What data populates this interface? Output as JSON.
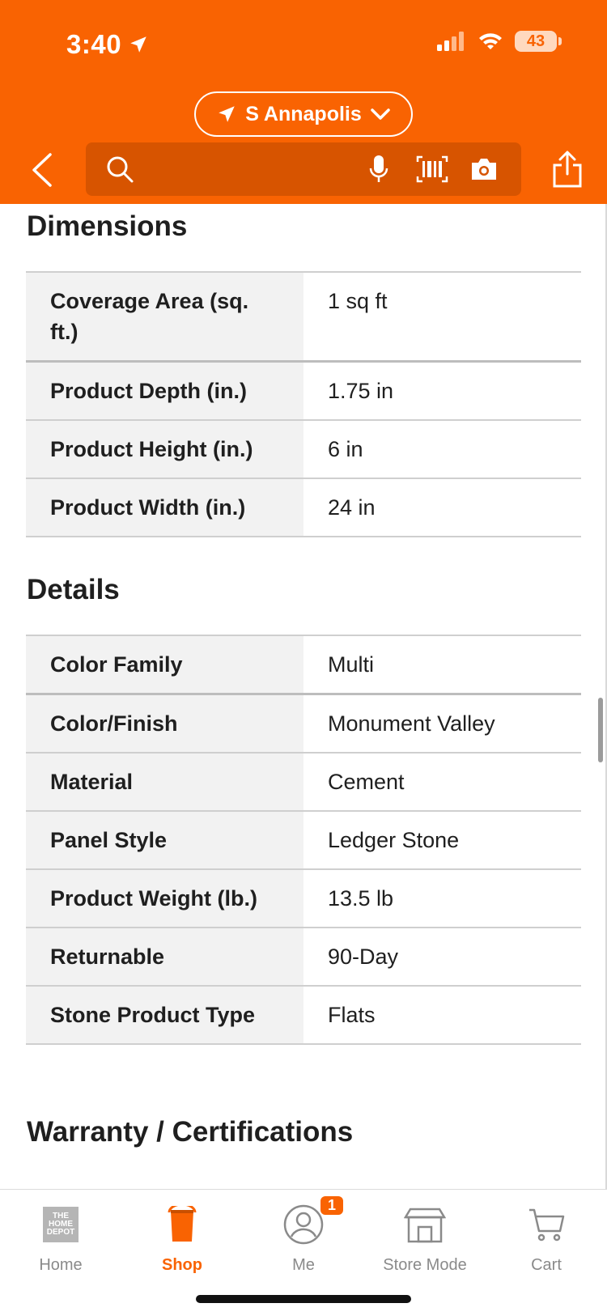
{
  "status_bar": {
    "time": "3:40",
    "battery": "43"
  },
  "header": {
    "store_name": "S Annapolis",
    "search_placeholder": ""
  },
  "sections": {
    "dimensions": {
      "title": "Dimensions",
      "rows": [
        {
          "label": "Coverage Area (sq. ft.)",
          "value": "1 sq ft"
        },
        {
          "label": "Product Depth (in.)",
          "value": "1.75 in"
        },
        {
          "label": "Product Height (in.)",
          "value": "6 in"
        },
        {
          "label": "Product Width (in.)",
          "value": "24 in"
        }
      ]
    },
    "details": {
      "title": "Details",
      "rows": [
        {
          "label": "Color Family",
          "value": "Multi"
        },
        {
          "label": "Color/Finish",
          "value": "Monument Valley"
        },
        {
          "label": "Material",
          "value": "Cement"
        },
        {
          "label": "Panel Style",
          "value": "Ledger Stone"
        },
        {
          "label": "Product Weight (lb.)",
          "value": "13.5 lb"
        },
        {
          "label": "Returnable",
          "value": "90-Day"
        },
        {
          "label": "Stone Product Type",
          "value": "Flats"
        }
      ]
    },
    "warranty": {
      "title": "Warranty / Certifications"
    }
  },
  "bottom_nav": {
    "home": "Home",
    "shop": "Shop",
    "me": "Me",
    "me_badge": "1",
    "store_mode": "Store Mode",
    "cart": "Cart",
    "logo_text": "THE HOME DEPOT"
  },
  "colors": {
    "brand": "#f96302",
    "label_bg": "#f2f2f2"
  }
}
